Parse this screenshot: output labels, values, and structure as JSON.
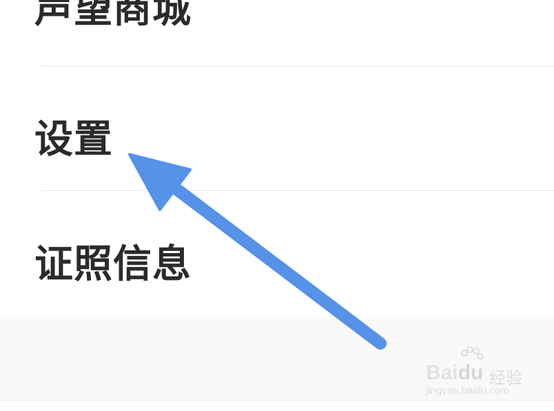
{
  "menu": {
    "items": [
      {
        "label": "声望商城"
      },
      {
        "label": "设置"
      },
      {
        "label": "证照信息"
      }
    ]
  },
  "watermark": {
    "brand": "Bai",
    "brand_accent": "du",
    "cn": "经验",
    "url": "jingyan.baidu.com"
  },
  "annotation": {
    "arrow_color": "#5592e8"
  }
}
